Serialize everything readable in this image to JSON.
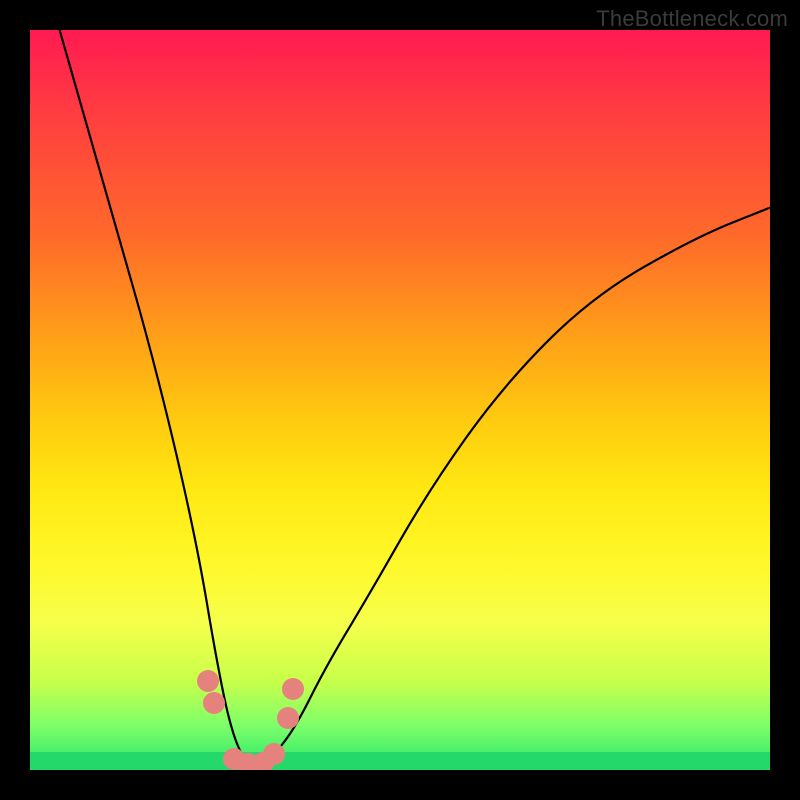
{
  "watermark": "TheBottleneck.com",
  "chart_data": {
    "type": "line",
    "title": "",
    "xlabel": "",
    "ylabel": "",
    "xlim": [
      0,
      100
    ],
    "ylim": [
      0,
      100
    ],
    "grid": false,
    "legend": false,
    "notes": "Gradient background encodes magnitude: red = high bottleneck, green = optimal. The black curve shows bottleneck percentage vs. an unlabeled x-axis, reaching a minimum (~0) near x≈30. Salmon-colored marker clusters highlight the near-optimal region around the minimum.",
    "series": [
      {
        "name": "bottleneck-curve",
        "x": [
          4,
          8,
          12,
          16,
          20,
          23,
          25,
          27,
          29,
          31,
          33,
          36,
          40,
          46,
          54,
          64,
          76,
          90,
          100
        ],
        "values": [
          100,
          86,
          72,
          58,
          42,
          28,
          16,
          6,
          1,
          0,
          2,
          6,
          14,
          24,
          38,
          52,
          64,
          72,
          76
        ]
      }
    ],
    "markers": [
      {
        "name": "left-cluster-top",
        "x": 24.0,
        "y": 12
      },
      {
        "name": "left-cluster-bottom",
        "x": 24.8,
        "y": 9
      },
      {
        "name": "valley-1",
        "x": 27.5,
        "y": 1.5
      },
      {
        "name": "valley-2",
        "x": 29.5,
        "y": 0.8
      },
      {
        "name": "valley-3",
        "x": 31.5,
        "y": 1.0
      },
      {
        "name": "valley-4",
        "x": 33.0,
        "y": 2.2
      },
      {
        "name": "right-cluster-bottom",
        "x": 34.8,
        "y": 7
      },
      {
        "name": "right-cluster-top",
        "x": 35.5,
        "y": 11
      }
    ],
    "gradient_stops": [
      {
        "pct": 0,
        "color": "#ff1a52"
      },
      {
        "pct": 12,
        "color": "#ff3f3f"
      },
      {
        "pct": 28,
        "color": "#ff6a2a"
      },
      {
        "pct": 40,
        "color": "#ff9a1a"
      },
      {
        "pct": 52,
        "color": "#ffc80f"
      },
      {
        "pct": 62,
        "color": "#ffe812"
      },
      {
        "pct": 72,
        "color": "#fff82a"
      },
      {
        "pct": 80,
        "color": "#f6ff4a"
      },
      {
        "pct": 88,
        "color": "#c8ff4a"
      },
      {
        "pct": 94,
        "color": "#7dff6a"
      },
      {
        "pct": 100,
        "color": "#24d96a"
      }
    ]
  }
}
